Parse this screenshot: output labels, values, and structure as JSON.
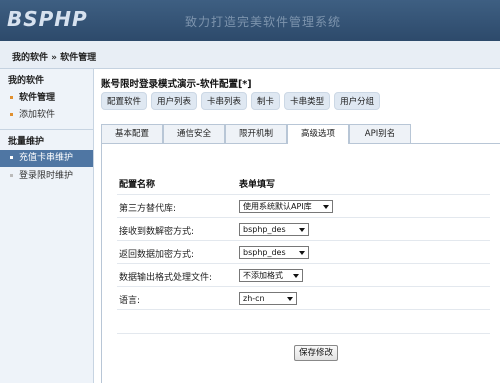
{
  "header": {
    "logo": "BSPHP",
    "slogan": "致力打造完美软件管理系统"
  },
  "breadcrumb": "我的软件 » 软件管理",
  "sidebar": {
    "group1": "我的软件",
    "items1": [
      {
        "label": "软件管理"
      },
      {
        "label": "添加软件"
      }
    ],
    "group2": "批量维护",
    "items2": [
      {
        "label": "充值卡串维护"
      },
      {
        "label": "登录限时维护"
      }
    ]
  },
  "main": {
    "title": "账号限时登录模式演示-软件配置[*]",
    "pills": [
      "配置软件",
      "用户列表",
      "卡串列表",
      "制卡",
      "卡串类型",
      "用户分组"
    ],
    "tabs": [
      "基本配置",
      "通信安全",
      "限开机制",
      "高级选项",
      "API别名"
    ],
    "active_tab": "高级选项",
    "col_name": "配置名称",
    "col_value": "表单填写",
    "rows": [
      {
        "label": "第三方替代库:",
        "value": "使用系统默认API库"
      },
      {
        "label": "接收到数解密方式:",
        "value": "bsphp_des"
      },
      {
        "label": "返回数据加密方式:",
        "value": "bsphp_des"
      },
      {
        "label": "数据输出格式处理文件:",
        "value": "不添加格式"
      },
      {
        "label": "语言:",
        "value": "zh-cn"
      }
    ],
    "save_label": "保存修改"
  }
}
